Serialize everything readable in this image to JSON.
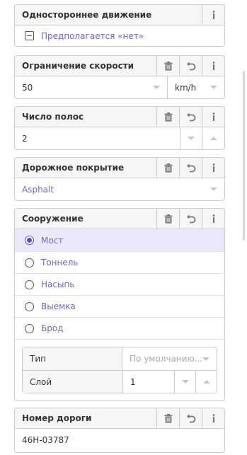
{
  "oneway": {
    "label": "Одностороннее движение",
    "value": "Предполагается «нет»"
  },
  "maxspeed": {
    "label": "Ограничение скорости",
    "value": "50",
    "unit": "km/h"
  },
  "lanes": {
    "label": "Число полос",
    "value": "2"
  },
  "surface": {
    "label": "Дорожное покрытие",
    "value": "Asphalt"
  },
  "structure": {
    "label": "Сооружение",
    "options": [
      "Мост",
      "Тоннель",
      "Насыпь",
      "Выемка",
      "Брод"
    ],
    "selected": "Мост",
    "type_label": "Тип",
    "type_placeholder": "По умолчанию...",
    "layer_label": "Слой",
    "layer_value": "1"
  },
  "ref": {
    "label": "Номер дороги",
    "value": "46H-03787"
  },
  "icons": {
    "remove": "trash-icon",
    "revert": "undo-icon",
    "info": "info-icon"
  },
  "colors": {
    "link": "#7067d8",
    "selected_bg": "#ebe8fc",
    "radio_on": "#5b4fd6"
  }
}
